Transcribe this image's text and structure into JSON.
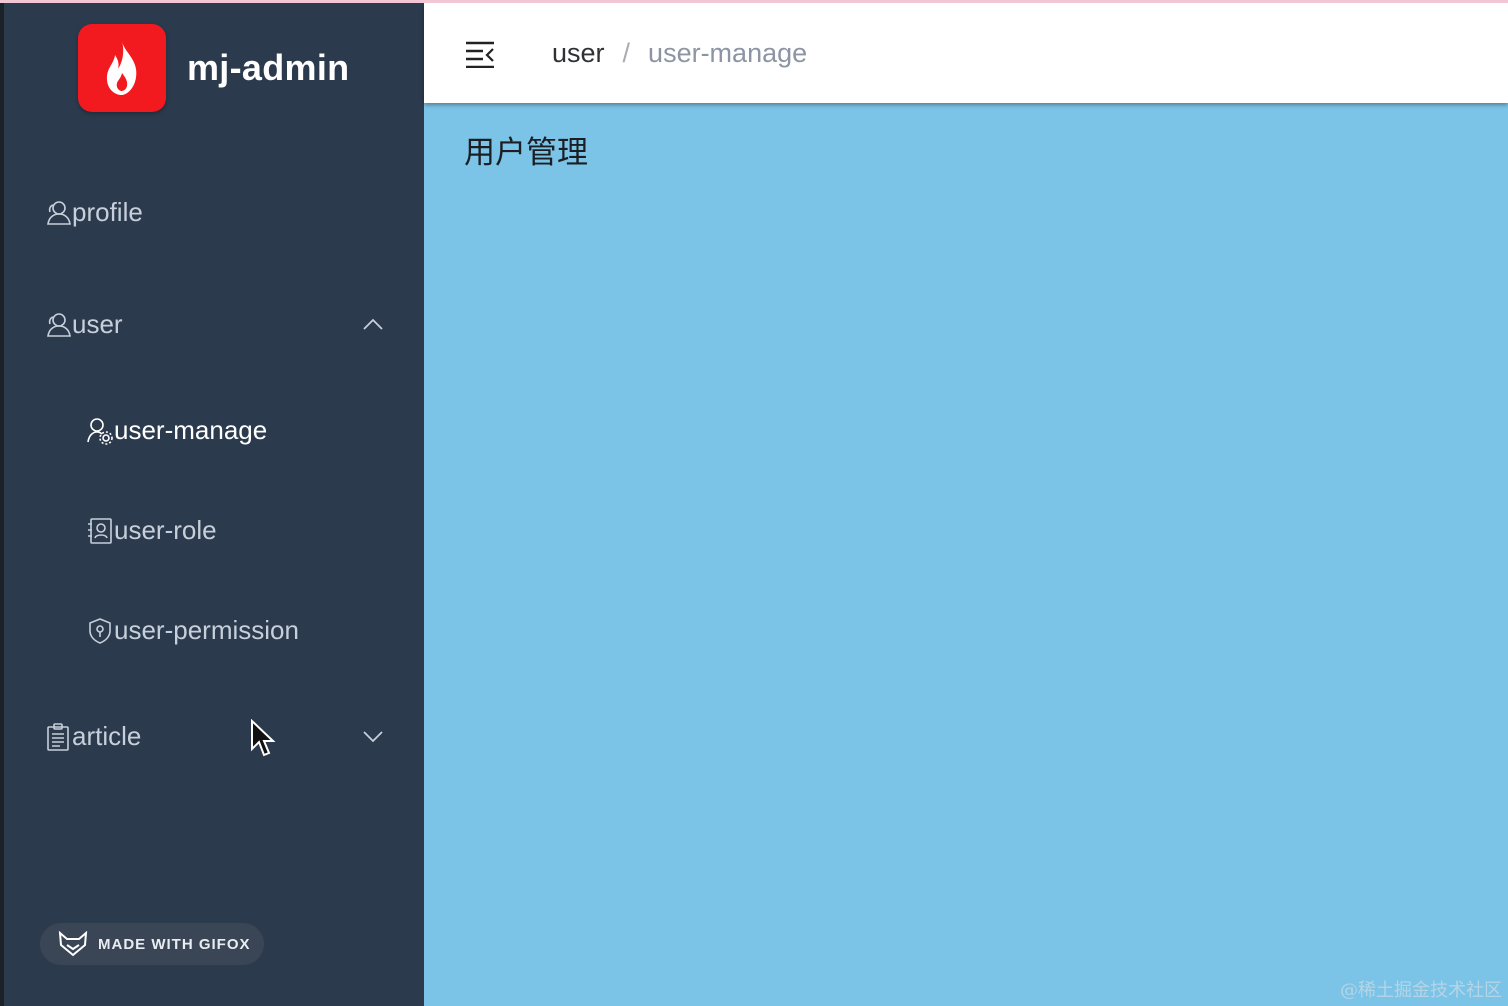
{
  "brand": {
    "name": "mj-admin",
    "logo_color": "#f2191f"
  },
  "sidebar": {
    "bg_color": "#2b3a4d",
    "items": [
      {
        "label": "profile",
        "icon": "user-icon"
      },
      {
        "label": "user",
        "icon": "user-icon",
        "expanded": true,
        "children": [
          {
            "label": "user-manage",
            "icon": "user-gear-icon",
            "active": true
          },
          {
            "label": "user-role",
            "icon": "contact-card-icon"
          },
          {
            "label": "user-permission",
            "icon": "shield-icon"
          }
        ]
      },
      {
        "label": "article",
        "icon": "clipboard-icon",
        "expanded": false
      }
    ]
  },
  "header": {
    "breadcrumb": [
      "user",
      "user-manage"
    ],
    "separator": "/"
  },
  "main": {
    "title": "用户管理",
    "bg_color": "#7bc4e7"
  },
  "badge": {
    "label": "MADE WITH GIFOX"
  },
  "watermark": "@稀土掘金技术社区"
}
